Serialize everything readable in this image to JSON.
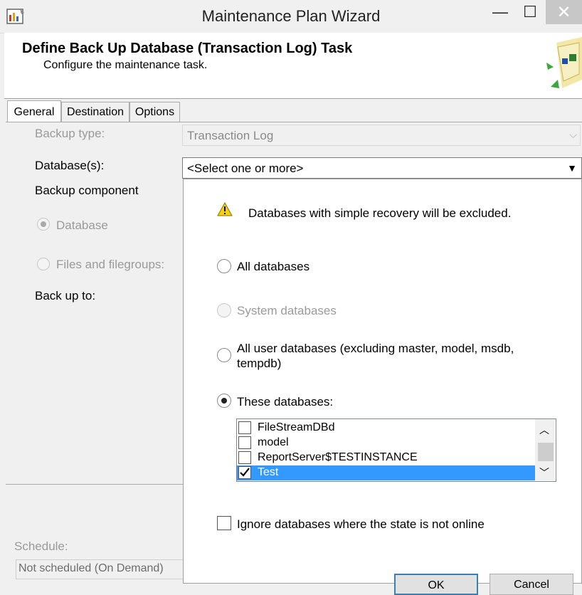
{
  "window": {
    "title": "Maintenance Plan Wizard",
    "minimize_glyph": "—",
    "maximize_glyph": "☐",
    "close_glyph": "✕",
    "icon": "wizard-app-icon"
  },
  "header": {
    "title": "Define Back Up Database (Transaction Log) Task",
    "subtitle": "Configure the maintenance task."
  },
  "tabs": [
    {
      "label": "General",
      "active": true
    },
    {
      "label": "Destination",
      "active": false
    },
    {
      "label": "Options",
      "active": false
    }
  ],
  "general": {
    "backup_type_label": "Backup type:",
    "backup_type_value": "Transaction Log",
    "databases_label": "Database(s):",
    "databases_value": "<Select one or more>",
    "backup_component_label": "Backup component",
    "component_database": "Database",
    "component_files": "Files and filegroups:",
    "back_up_to_label": "Back up to:",
    "schedule_label": "Schedule:",
    "schedule_value": "Not scheduled (On Demand)"
  },
  "popup": {
    "warning_text": "Databases with simple recovery will be excluded.",
    "option_all": "All databases",
    "option_system": "System databases",
    "option_user_line1": "All user databases  (excluding master, model, msdb,",
    "option_user_line2": "tempdb)",
    "option_these": "These databases:",
    "selected_option": "These databases:",
    "databases": [
      {
        "name": "FileStreamDBd",
        "checked": false,
        "selected": false
      },
      {
        "name": "model",
        "checked": false,
        "selected": false
      },
      {
        "name": "ReportServer$TESTINSTANCE",
        "checked": false,
        "selected": false
      },
      {
        "name": "Test",
        "checked": true,
        "selected": true
      }
    ],
    "ignore_offline_label": "Ignore databases where the state is not online",
    "ignore_offline_checked": false,
    "ok_label": "OK",
    "cancel_label": "Cancel"
  },
  "colors": {
    "selection": "#3399ff",
    "disabled_text": "#9a9a9a",
    "close_button": "#c7c7c7",
    "warning": "#f5d200"
  }
}
